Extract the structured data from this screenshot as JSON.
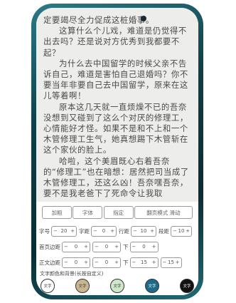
{
  "reader": {
    "paragraphs": [
      "定要竭尽全力促成这桩婚事。",
      "这算什么个儿戏，难道是仍觉得不出去吗？还是说对方优秀到我都要不起？",
      "为什么去中国留学的时候父亲不告诉自己，难道是害怕自己退婚吗？你不要当年非要自己去中国留学，原来在这儿等着啊！",
      "原本这几天就一直烦燥不已的吾奈没想到又碰到了这么个对厌的修理工，心情能好才怪。如果不是和不上和一个木管修理工生气，她真想踢下木管斩在这个家伙的脸上。",
      "哈啦，这个美眉既心右着吾奈的“修理工”也在暗想：居然把司当成了木管修理工，还这么凶！吾奈嘿吾奈，要不是我老爸下了死命令让我取"
    ]
  },
  "panel": {
    "buttons": [
      "加粗",
      "字体",
      "指定",
      "翻页模式 滑动"
    ],
    "row1": {
      "size_label": "字号",
      "size_value": "20",
      "spacing_label": "字距",
      "spacing_value": "0",
      "line_label": "行距",
      "line_value": "10",
      "para_label": "段距",
      "para_value": "10"
    },
    "row2": {
      "label": "首页边距",
      "v1": "0",
      "v2": "0",
      "label2": "下",
      "v3": "0"
    },
    "row3": {
      "label": "正文边距",
      "v1": "0",
      "v2": "0",
      "label2": "下",
      "v3": "15",
      "v4": "15"
    },
    "bg_title": "文字颜色和背景(长按自定义)",
    "swatch_label": "文字",
    "swatches": [
      "#ffffff",
      "#c8b690",
      "#cfe6c8",
      "#1d6b88",
      "#111111"
    ],
    "swatch_text_colors": [
      "#333333",
      "#333333",
      "#333333",
      "#ffffff",
      "#ffffff"
    ]
  }
}
